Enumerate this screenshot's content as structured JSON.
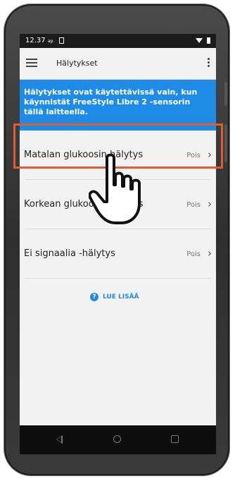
{
  "status_bar": {
    "time": "12.37",
    "time_suffix": "ap."
  },
  "app_bar": {
    "title": "Hälytykset",
    "menu_icon": "hamburger-menu-icon",
    "more_icon": "more-vert-icon"
  },
  "banner": {
    "text": "Hälytykset ovat käytettävissä vain, kun käynnistät FreeStyle Libre 2 -sensorin tällä laitteella."
  },
  "alarms": [
    {
      "label": "Matalan glukoosin hälytys",
      "value": "Pois"
    },
    {
      "label": "Korkean glukoosin hälytys",
      "value": "Pois"
    },
    {
      "label": "Ei signaalia -hälytys",
      "value": "Pois"
    }
  ],
  "learn_more": {
    "label": "LUE LISÄÄ",
    "icon": "help-icon"
  },
  "colors": {
    "accent": "#1e8ce6",
    "highlight": "#e35a2b",
    "status_bar": "#1b1b1b",
    "nav_bar": "#0d0d0d"
  },
  "overlay": {
    "icon": "pointing-hand-icon",
    "highlighted_item": "Matalan glukoosin hälytys"
  }
}
